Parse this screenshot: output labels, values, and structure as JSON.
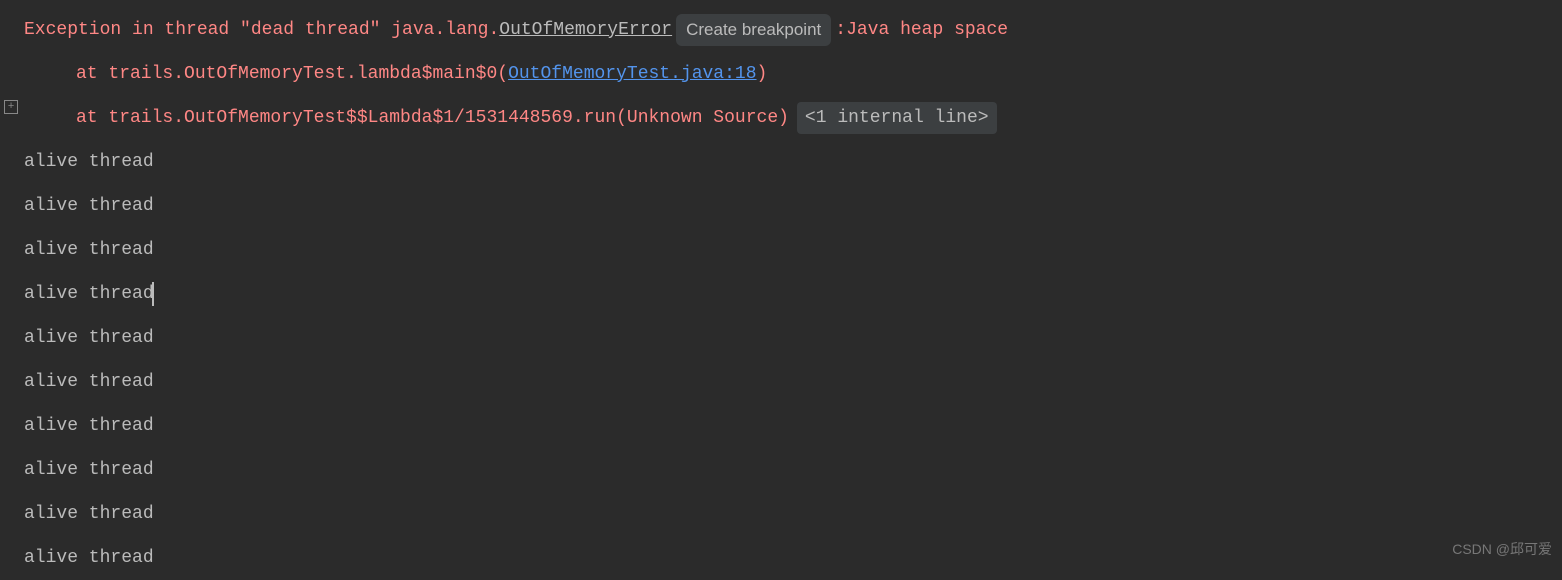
{
  "exception": {
    "prefix": "Exception in thread \"dead thread\" java.lang.",
    "errorClass": "OutOfMemoryError",
    "breakpointAction": "Create breakpoint",
    "sep": " : ",
    "message": "Java heap space",
    "frames": [
      {
        "prefix": "at trails.OutOfMemoryTest.lambda$main$0(",
        "link": "OutOfMemoryTest.java:18",
        "suffix": ")"
      },
      {
        "prefix": "at trails.OutOfMemoryTest$$Lambda$1/1531448569.run(Unknown Source)",
        "link": "",
        "suffix": "",
        "hint": "<1 internal line>"
      }
    ],
    "expandIcon": "+"
  },
  "output": [
    "alive thread",
    "alive thread",
    "alive thread",
    "alive thread",
    "alive thread",
    "alive thread",
    "alive thread",
    "alive thread",
    "alive thread",
    "alive thread"
  ],
  "cursorLine": 3,
  "watermark": "CSDN @邱可爱"
}
